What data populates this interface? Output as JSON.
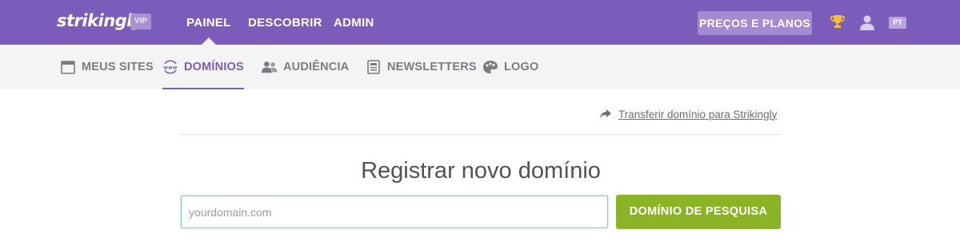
{
  "brand": {
    "logo_text": "strikingly",
    "badge": "VIP"
  },
  "topnav": [
    {
      "label": "PAINEL",
      "active": true
    },
    {
      "label": "DESCOBRIR",
      "active": false
    },
    {
      "label": "ADMIN",
      "active": false
    }
  ],
  "header_actions": {
    "pricing_label": "PREÇOS E PLANOS",
    "language": "PT",
    "icons": [
      "trophy-icon",
      "user-icon"
    ]
  },
  "subnav": [
    {
      "label": "MEUS SITES",
      "icon": "browser-window-icon",
      "active": false
    },
    {
      "label": "DOMÍNIOS",
      "icon": "www-globe-icon",
      "active": true
    },
    {
      "label": "AUDIÊNCIA",
      "icon": "people-icon",
      "active": false
    },
    {
      "label": "NEWSLETTERS",
      "icon": "newsletter-icon",
      "active": false
    },
    {
      "label": "LOGO",
      "icon": "palette-icon",
      "active": false
    }
  ],
  "main": {
    "transfer_link": "Transferir domínio para Strikingly",
    "heading": "Registrar novo domínio",
    "domain_input": {
      "value": "",
      "placeholder": "yourdomain.com"
    },
    "search_button": "DOMÍNIO DE PESQUISA"
  },
  "colors": {
    "brand_purple": "#7c5cba",
    "pricing_button": "#a48bd1",
    "subnav_bg": "#f4f4f4",
    "search_green": "#8ab326",
    "input_focus": "#7ec8e6"
  }
}
